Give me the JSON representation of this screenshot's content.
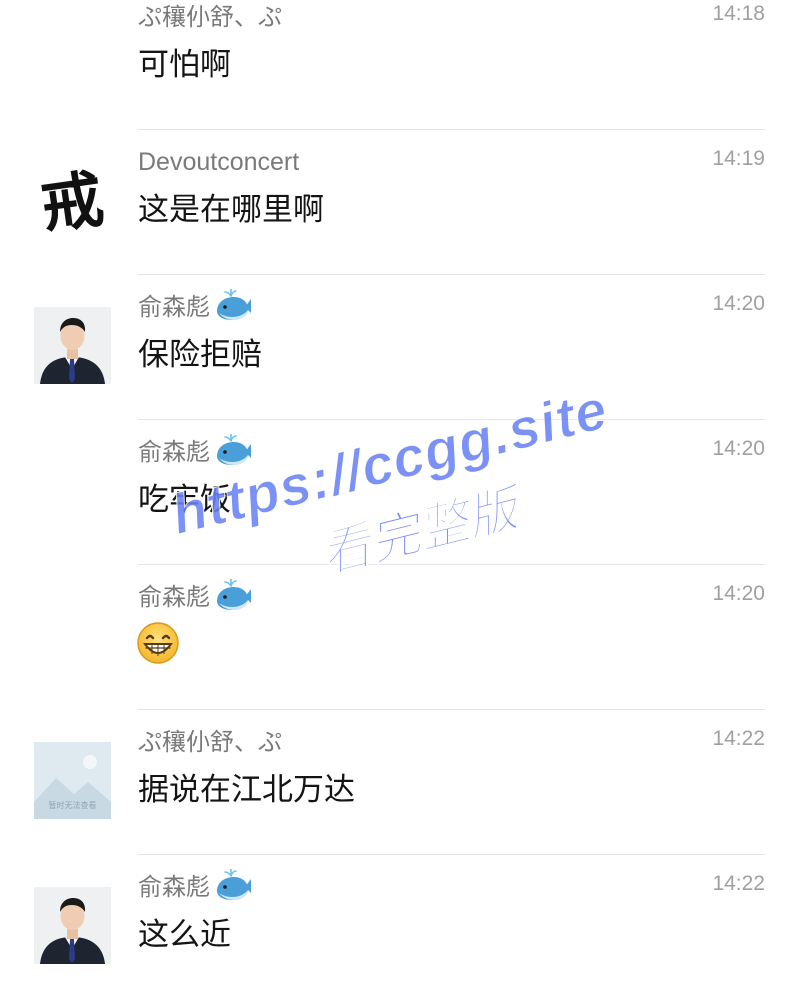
{
  "messages": [
    {
      "sender": "ぷ穰仦舒、ぷ",
      "time": "14:18",
      "text": "可怕啊",
      "avatar": "none",
      "whale": false
    },
    {
      "sender": "Devoutconcert",
      "time": "14:19",
      "text": "这是在哪里啊",
      "avatar": "calligraphy-jie",
      "avatar_char": "戒",
      "whale": false
    },
    {
      "sender": "俞森彪",
      "time": "14:20",
      "text": "保险拒赔",
      "avatar": "man-in-suit",
      "whale": true
    },
    {
      "sender": "俞森彪",
      "time": "14:20",
      "text": "吃牢饭",
      "avatar": "none",
      "whale": true
    },
    {
      "sender": "俞森彪",
      "time": "14:20",
      "text": "",
      "emoji": "grinning-face-emoji",
      "avatar": "none",
      "whale": true
    },
    {
      "sender": "ぷ穰仦舒、ぷ",
      "time": "14:22",
      "text": "据说在江北万达",
      "avatar": "placeholder-image",
      "avatar_caption": "暂时无法查看",
      "whale": false
    },
    {
      "sender": "俞森彪",
      "time": "14:22",
      "text": "这么近",
      "avatar": "man-in-suit",
      "whale": true
    }
  ],
  "watermark": {
    "line1": "https://ccgg.site",
    "line2": "看完整版",
    "color": "#6a82f5"
  },
  "colors": {
    "sender": "#7a7a7a",
    "time": "#a0a0a0",
    "text": "#141414",
    "divider": "#e5e5e5"
  }
}
